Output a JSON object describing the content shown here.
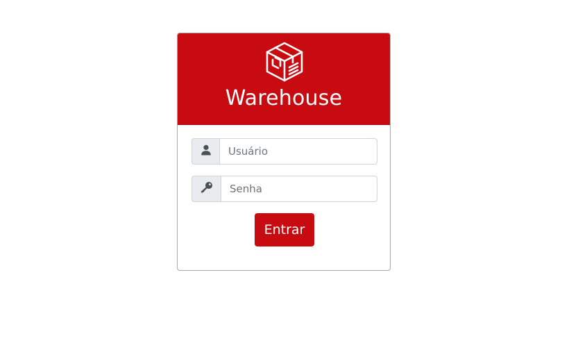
{
  "brand": {
    "title": "Warehouse",
    "logo_icon": "box-package-icon"
  },
  "login": {
    "username": {
      "icon": "user-icon",
      "placeholder": "Usuário",
      "value": ""
    },
    "password": {
      "icon": "key-icon",
      "placeholder": "Senha",
      "value": ""
    },
    "submit_label": "Entrar"
  },
  "colors": {
    "brand_red": "#c80b11",
    "addon_bg": "#e9ecef",
    "icon_gray": "#495057"
  }
}
